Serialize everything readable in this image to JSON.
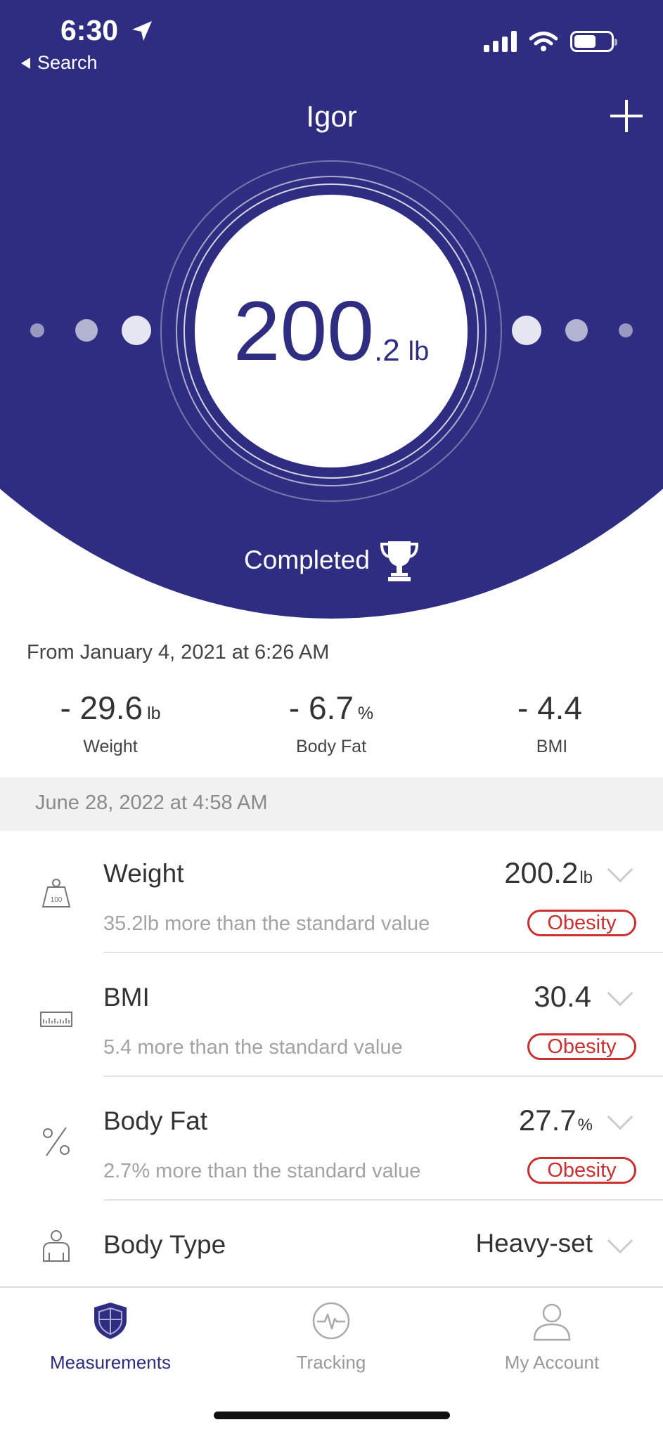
{
  "status_bar": {
    "time": "6:30",
    "back_label": "Search"
  },
  "header": {
    "user_name": "Igor",
    "weight_whole": "200",
    "weight_decimal": ".2",
    "weight_unit": "lb",
    "status": "Completed"
  },
  "summary": {
    "from_text": "From January 4, 2021 at 6:26 AM",
    "items": [
      {
        "value": "- 29.6",
        "unit": "lb",
        "label": "Weight"
      },
      {
        "value": "- 6.7",
        "unit": "%",
        "label": "Body Fat"
      },
      {
        "value": "- 4.4",
        "unit": "",
        "label": "BMI"
      }
    ]
  },
  "measurement_date": "June 28, 2022 at 4:58 AM",
  "metrics": [
    {
      "name": "Weight",
      "value": "200.2",
      "unit": "lb",
      "description": "35.2lb more than the standard value",
      "badge": "Obesity",
      "icon": "weight-scale-icon"
    },
    {
      "name": "BMI",
      "value": "30.4",
      "unit": "",
      "description": "5.4 more than the standard value",
      "badge": "Obesity",
      "icon": "bmi-chart-icon"
    },
    {
      "name": "Body Fat",
      "value": "27.7",
      "unit": "%",
      "description": "2.7% more than the standard value",
      "badge": "Obesity",
      "icon": "percent-icon"
    },
    {
      "name": "Body Type",
      "value": "Heavy-set",
      "unit": "",
      "icon": "body-icon"
    }
  ],
  "tabs": [
    {
      "label": "Measurements",
      "icon": "shield-icon",
      "active": true
    },
    {
      "label": "Tracking",
      "icon": "pulse-icon",
      "active": false
    },
    {
      "label": "My Account",
      "icon": "person-icon",
      "active": false
    }
  ],
  "colors": {
    "primary": "#2e2d82",
    "alert": "#cc2f2f"
  }
}
